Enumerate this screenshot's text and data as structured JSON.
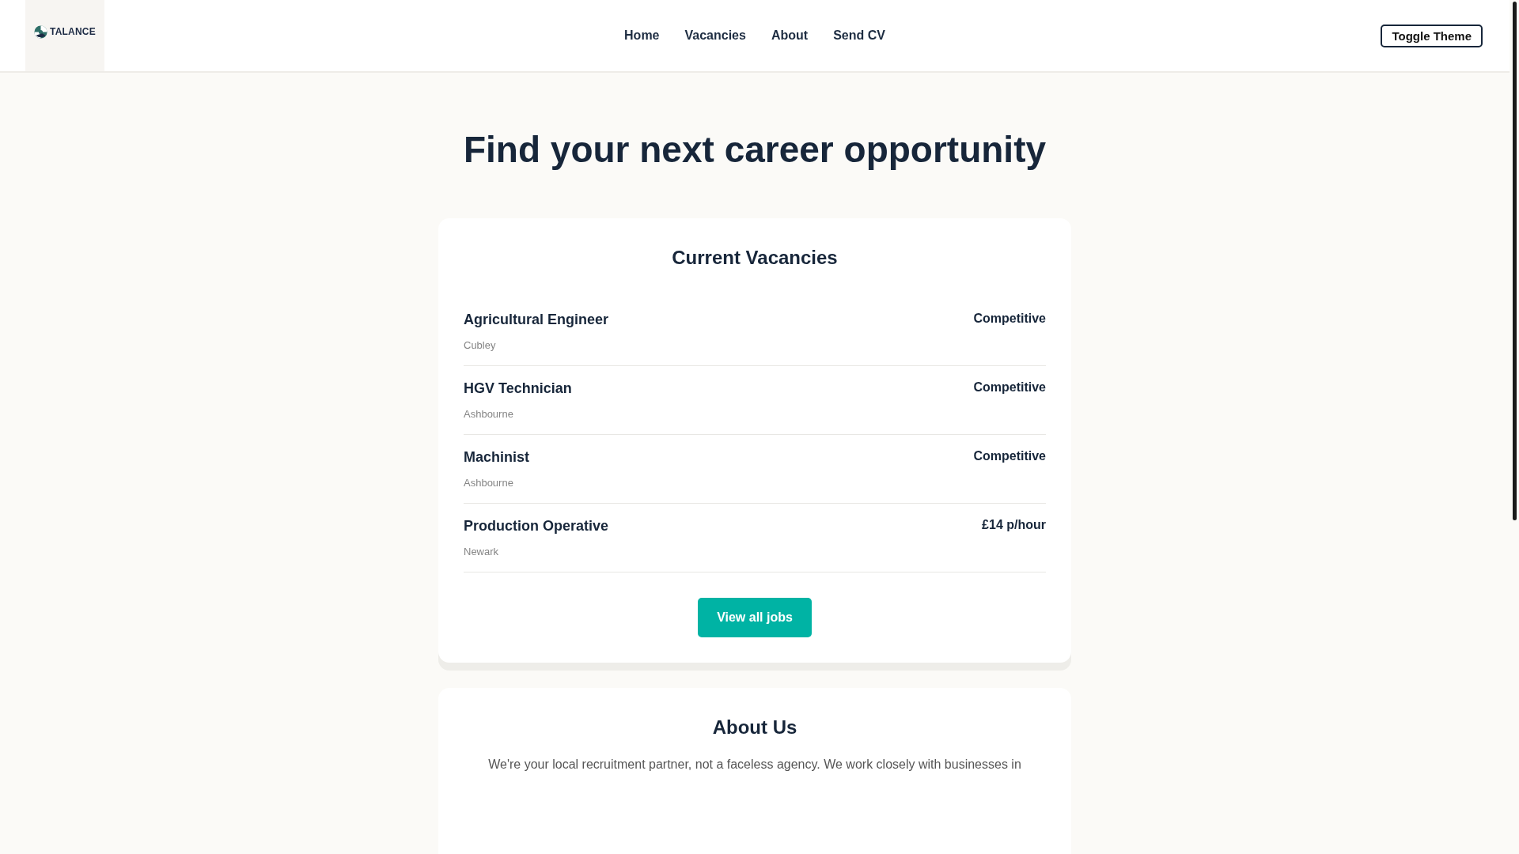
{
  "header": {
    "logo": "TALANCE",
    "nav": [
      {
        "label": "Home"
      },
      {
        "label": "Vacancies"
      },
      {
        "label": "About"
      },
      {
        "label": "Send CV"
      }
    ],
    "theme_button": "Toggle Theme"
  },
  "hero": {
    "title": "Find your next career opportunity"
  },
  "vacancies": {
    "title": "Current Vacancies",
    "jobs": [
      {
        "title": "Agricultural Engineer",
        "location": "Cubley",
        "pay": "Competitive"
      },
      {
        "title": "HGV Technician",
        "location": "Ashbourne",
        "pay": "Competitive"
      },
      {
        "title": "Machinist",
        "location": "Ashbourne",
        "pay": "Competitive"
      },
      {
        "title": "Production Operative",
        "location": "Newark",
        "pay": "£14 p/hour"
      }
    ],
    "button": "View all jobs"
  },
  "about": {
    "title": "About Us",
    "text": "We're your local recruitment partner, not a faceless agency. We work closely with businesses in"
  }
}
